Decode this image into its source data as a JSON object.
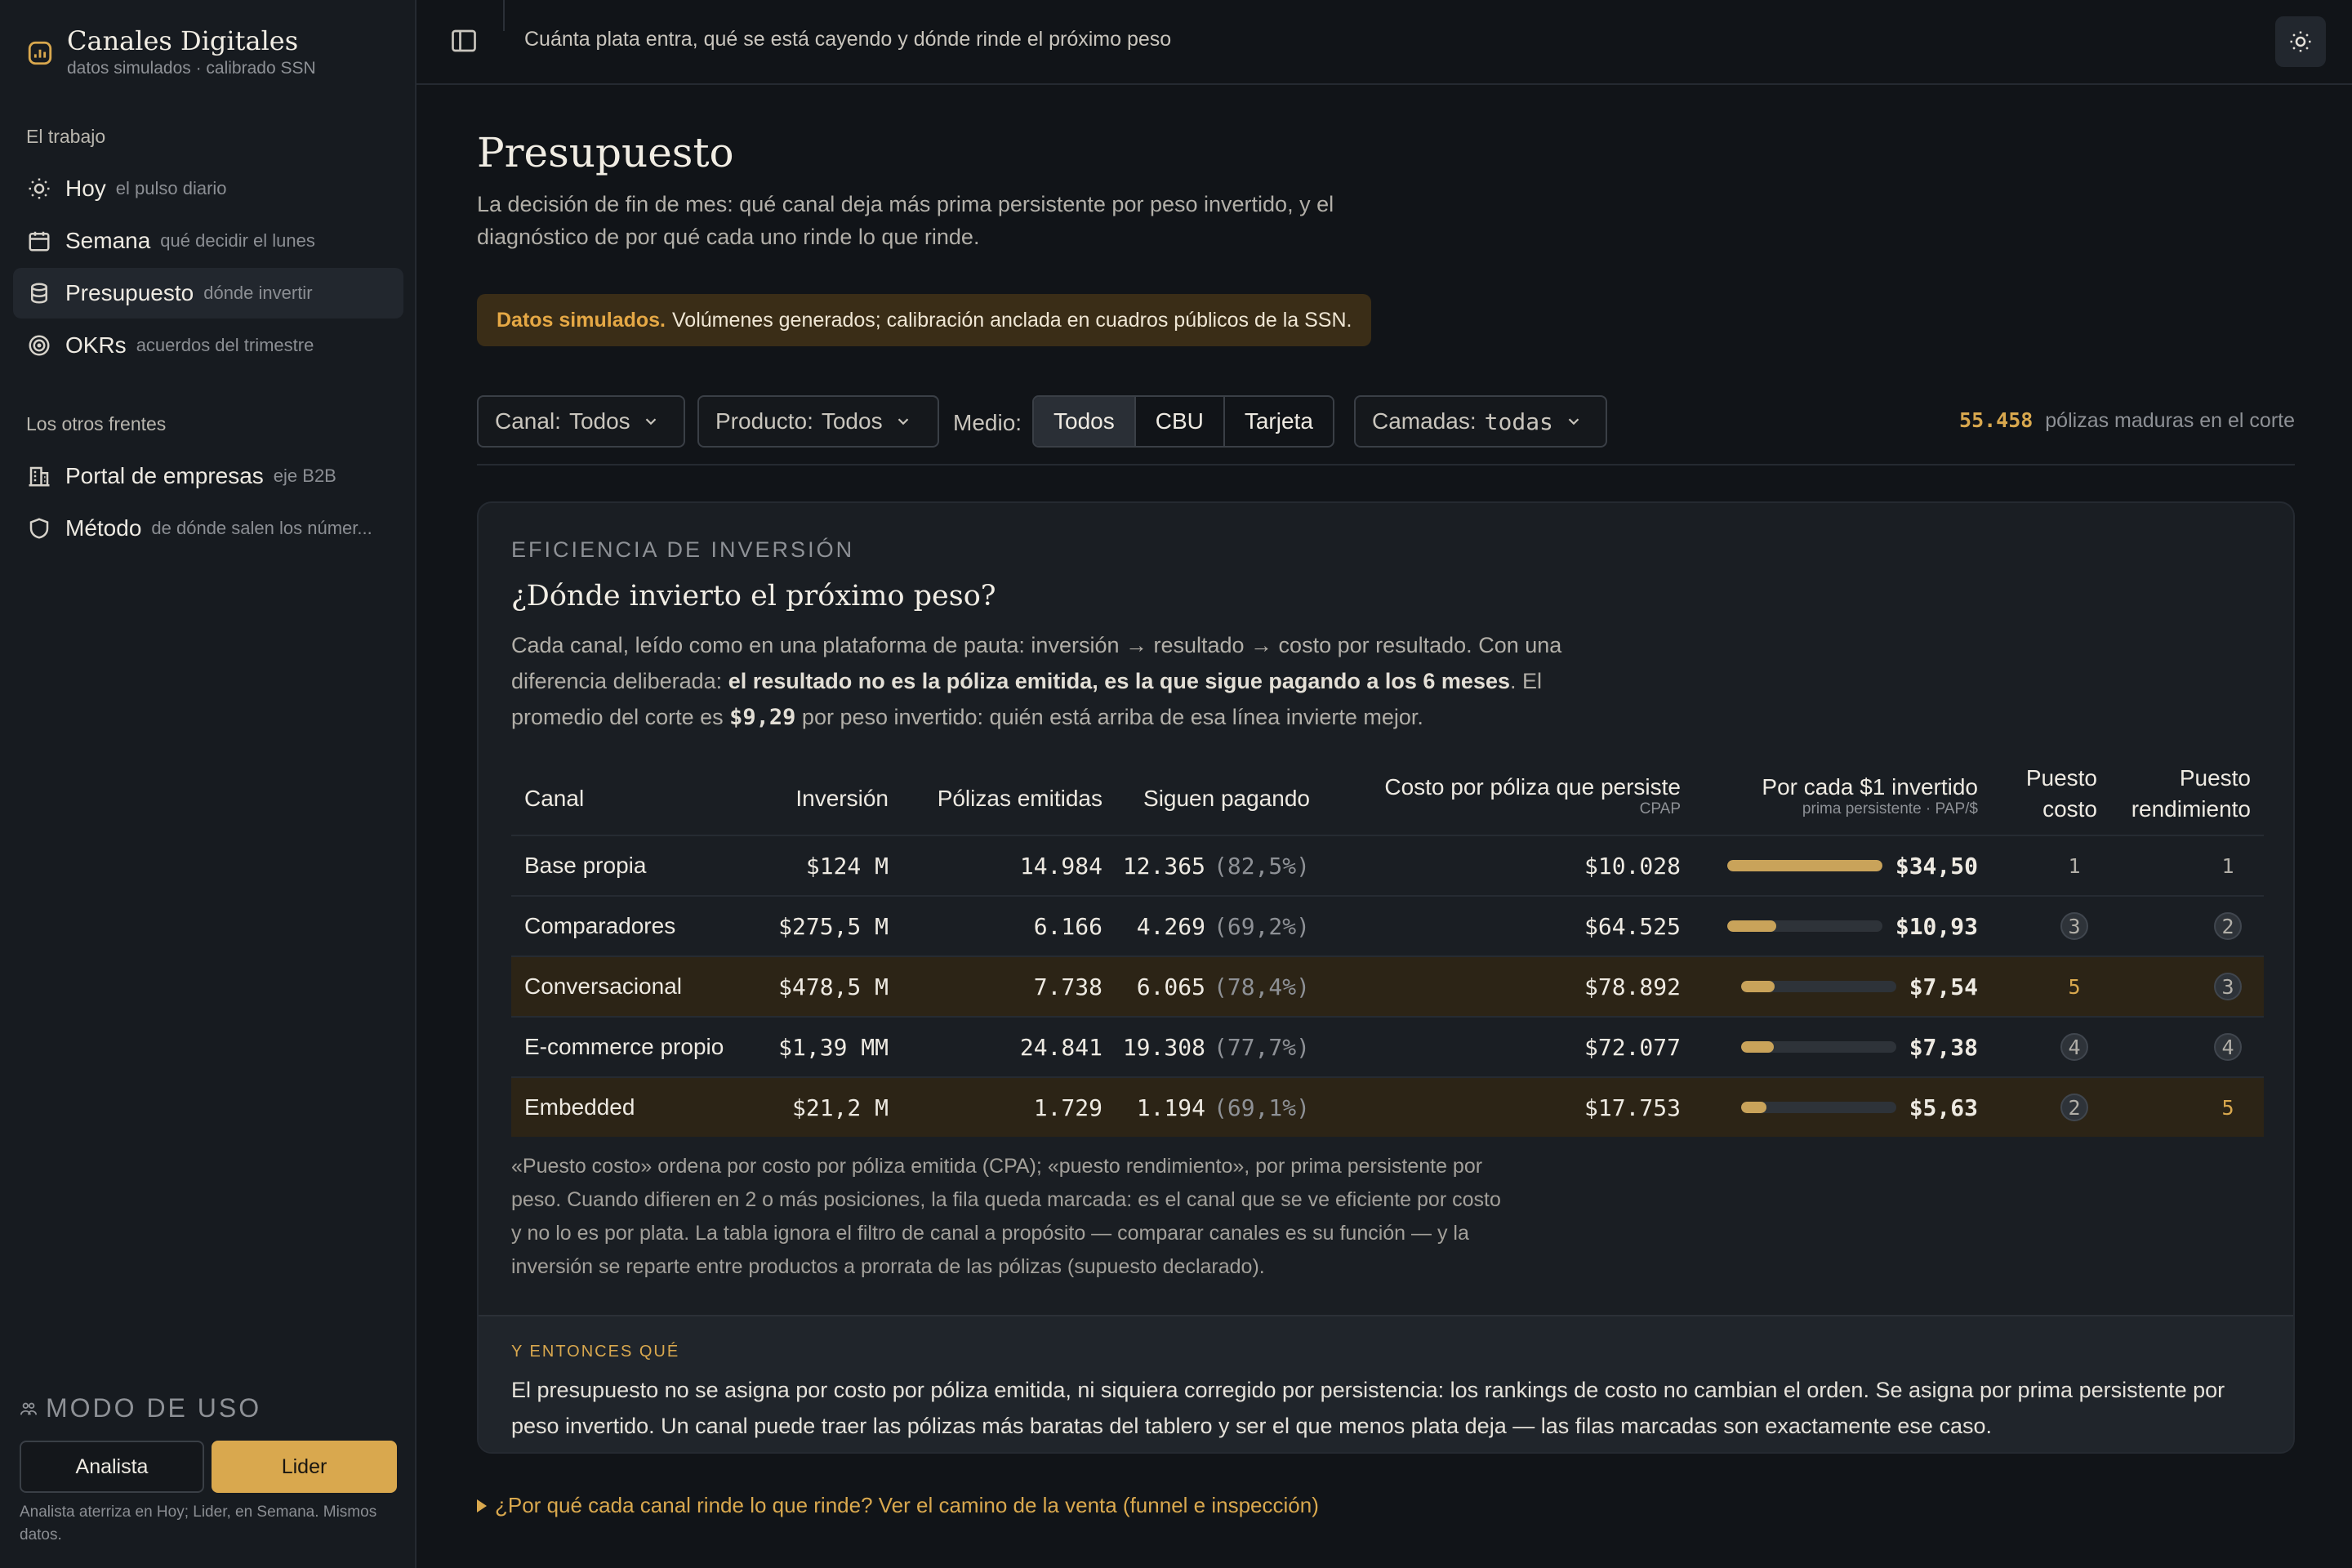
{
  "brand": {
    "title": "Canales Digitales",
    "subtitle": "datos simulados · calibrado SSN"
  },
  "sidebar": {
    "section_work": "El trabajo",
    "work_items": [
      {
        "label": "Hoy",
        "hint": "el pulso diario",
        "icon": "sun-icon"
      },
      {
        "label": "Semana",
        "hint": "qué decidir el lunes",
        "icon": "calendar-icon"
      },
      {
        "label": "Presupuesto",
        "hint": "dónde invertir",
        "icon": "coins-icon",
        "active": true
      },
      {
        "label": "OKRs",
        "hint": "acuerdos del trimestre",
        "icon": "target-icon"
      }
    ],
    "section_other": "Los otros frentes",
    "other_items": [
      {
        "label": "Portal de empresas",
        "hint": "eje B2B",
        "icon": "building-icon"
      },
      {
        "label": "Método",
        "hint": "de dónde salen los númer...",
        "icon": "shield-icon"
      }
    ],
    "mode": {
      "title": "MODO DE USO",
      "options": [
        "Analista",
        "Lider"
      ],
      "selected": "Lider",
      "note": "Analista aterriza en Hoy; Lider, en Semana. Mismos datos."
    }
  },
  "topbar": {
    "tagline": "Cuánta plata entra, qué se está cayendo y dónde rinde el próximo peso"
  },
  "page": {
    "title": "Presupuesto",
    "subtitle": "La decisión de fin de mes: qué canal deja más prima persistente por peso invertido, y el diagnóstico de por qué cada uno rinde lo que rinde.",
    "notice_bold": "Datos simulados.",
    "notice_text": "Volúmenes generados; calibración anclada en cuadros públicos de la SSN."
  },
  "filters": {
    "canal_label": "Canal:",
    "canal_value": "Todos",
    "producto_label": "Producto:",
    "producto_value": "Todos",
    "medio_label": "Medio:",
    "medio_options": [
      "Todos",
      "CBU",
      "Tarjeta"
    ],
    "medio_selected": "Todos",
    "camadas_label": "Camadas:",
    "camadas_value": "todas",
    "count_value": "55.458",
    "count_text": "pólizas maduras en el corte"
  },
  "card": {
    "eyebrow": "EFICIENCIA DE INVERSIÓN",
    "title": "¿Dónde invierto el próximo peso?",
    "desc_1": "Cada canal, leído como en una plataforma de pauta: inversión → resultado → costo por resultado. Con una diferencia deliberada: ",
    "desc_bold": "el resultado no es la póliza emitida, es la que sigue pagando a los 6 meses",
    "desc_2": ". El promedio del corte es ",
    "desc_avg": "$9,29",
    "desc_3": " por peso invertido: quién está arriba de esa línea invierte mejor.",
    "columns": {
      "canal": "Canal",
      "inversion": "Inversión",
      "emitidas": "Pólizas emitidas",
      "siguen": "Siguen pagando",
      "costo": "Costo por póliza que persiste",
      "costo_sub": "CPAP",
      "rinde": "Por cada $1 invertido",
      "rinde_sub": "prima persistente · PAP/$",
      "puesto_costo_1": "Puesto",
      "puesto_costo_2": "costo",
      "puesto_rend_1": "Puesto",
      "puesto_rend_2": "rendimiento"
    },
    "rows": [
      {
        "canal": "Base propia",
        "inversion": "$124 M",
        "emitidas": "14.984",
        "siguen": "12.365",
        "pct": "(82,5%)",
        "costo": "$10.028",
        "rinde": "$34,50",
        "rinde_value": 34.5,
        "puesto_costo": "1",
        "puesto_rend": "1",
        "marked": false
      },
      {
        "canal": "Comparadores",
        "inversion": "$275,5 M",
        "emitidas": "6.166",
        "siguen": "4.269",
        "pct": "(69,2%)",
        "costo": "$64.525",
        "rinde": "$10,93",
        "rinde_value": 10.93,
        "puesto_costo": "3",
        "puesto_rend": "2",
        "marked": false
      },
      {
        "canal": "Conversacional",
        "inversion": "$478,5 M",
        "emitidas": "7.738",
        "siguen": "6.065",
        "pct": "(78,4%)",
        "costo": "$78.892",
        "rinde": "$7,54",
        "rinde_value": 7.54,
        "puesto_costo": "5",
        "puesto_rend": "3",
        "marked": true
      },
      {
        "canal": "E-commerce propio",
        "inversion": "$1,39 MM",
        "emitidas": "24.841",
        "siguen": "19.308",
        "pct": "(77,7%)",
        "costo": "$72.077",
        "rinde": "$7,38",
        "rinde_value": 7.38,
        "puesto_costo": "4",
        "puesto_rend": "4",
        "marked": false
      },
      {
        "canal": "Embedded",
        "inversion": "$21,2 M",
        "emitidas": "1.729",
        "siguen": "1.194",
        "pct": "(69,1%)",
        "costo": "$17.753",
        "rinde": "$5,63",
        "rinde_value": 5.63,
        "puesto_costo": "2",
        "puesto_rend": "5",
        "marked": true
      }
    ],
    "footnote": "«Puesto costo» ordena por costo por póliza emitida (CPA); «puesto rendimiento», por prima persistente por peso. Cuando difieren en 2 o más posiciones, la fila queda marcada: es el canal que se ve eficiente por costo y no lo es por plata. La tabla ignora el filtro de canal a propósito — comparar canales es su función — y la inversión se reparte entre productos a prorrata de las pólizas (supuesto declarado).",
    "sowhat_label": "Y ENTONCES QUÉ",
    "sowhat_text": "El presupuesto no se asigna por costo por póliza emitida, ni siquiera corregido por persistencia: los rankings de costo no cambian el orden. Se asigna por prima persistente por peso invertido. Un canal puede traer las pólizas más baratas del tablero y ser el que menos plata deja — las filas marcadas son exactamente ese caso."
  },
  "disclosure": "¿Por qué cada canal rinde lo que rinde? Ver el camino de la venta (funnel e inspección)",
  "colors": {
    "accent": "#d9a84e",
    "marked_row": "#2c2416",
    "bar_fill": "#c9a35a"
  }
}
